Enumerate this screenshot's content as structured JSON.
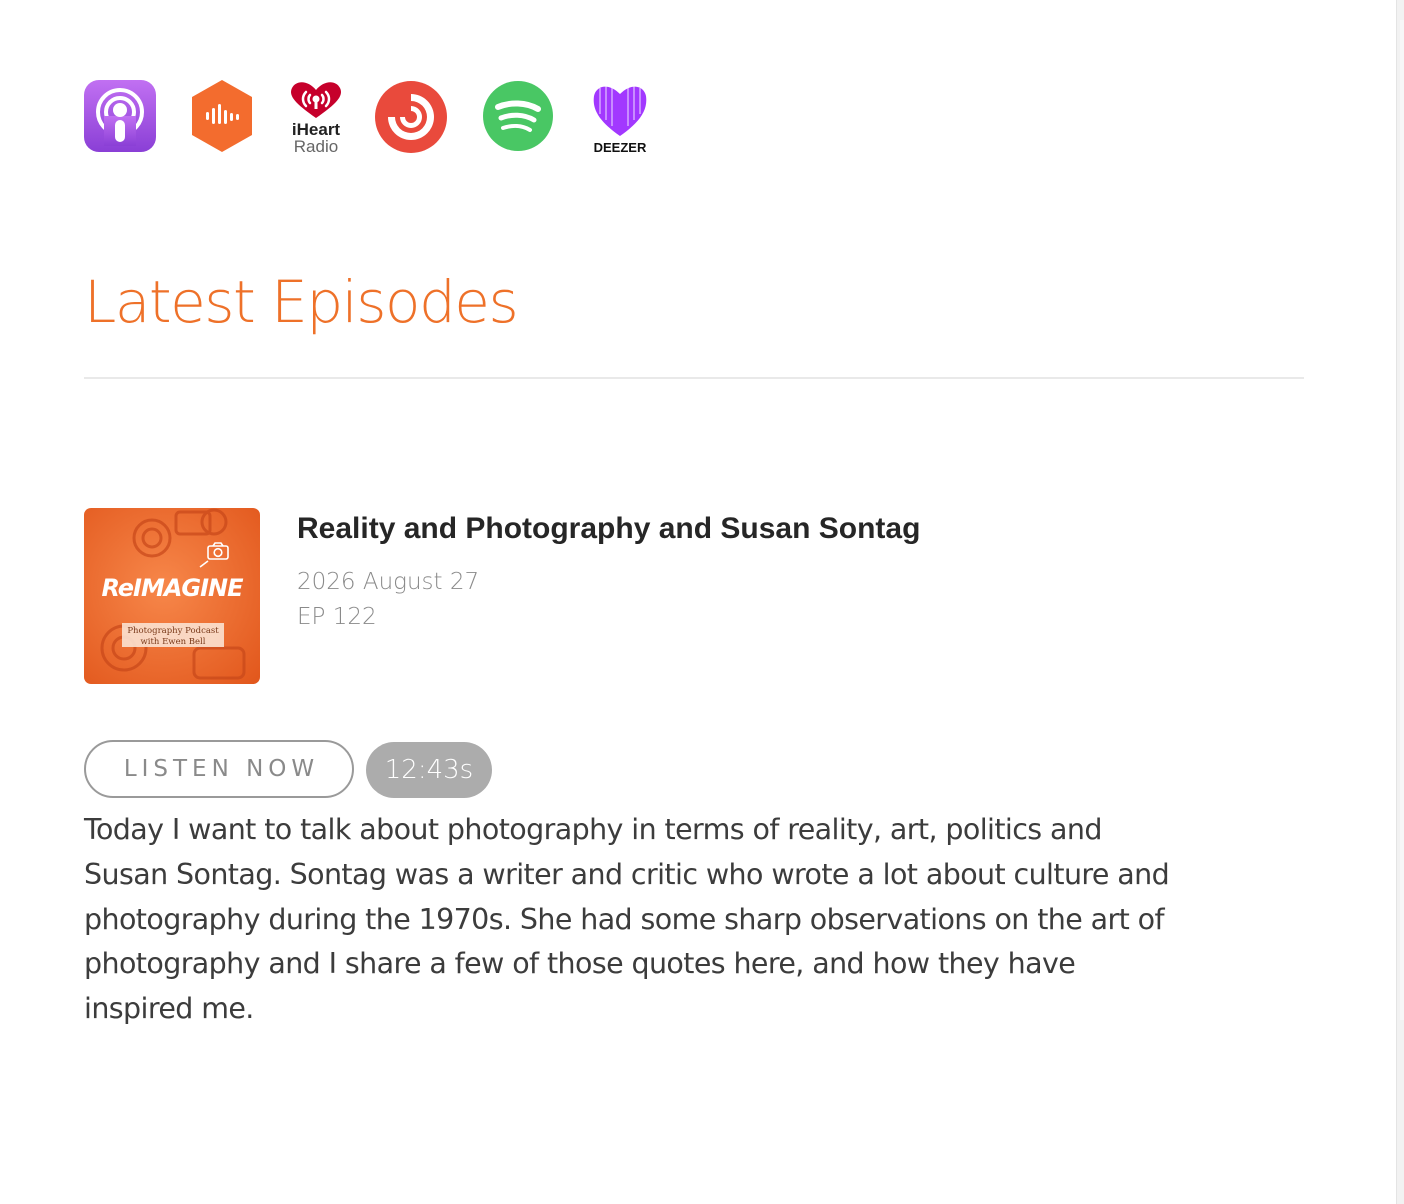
{
  "platforms": [
    {
      "name": "Apple Podcasts",
      "icon": "apple-podcasts-icon",
      "color": "#9B4DDF"
    },
    {
      "name": "Castbox",
      "icon": "castbox-icon",
      "color": "#F26B2D"
    },
    {
      "name": "iHeartRadio",
      "icon": "iheartradio-icon",
      "color": "#C6002B",
      "logo_text": [
        "iHeart",
        "Radio"
      ]
    },
    {
      "name": "Pocket Casts",
      "icon": "pocket-casts-icon",
      "color": "#F43E37"
    },
    {
      "name": "Spotify",
      "icon": "spotify-icon",
      "color": "#1ED760"
    },
    {
      "name": "Deezer",
      "icon": "deezer-icon",
      "color": "#A238FF",
      "logo_text": "DEEZER"
    }
  ],
  "section": {
    "title": "Latest Episodes"
  },
  "episode": {
    "cover": {
      "logo_text": "ReIMAGINE",
      "subtitle_lines": [
        "Photography Podcast",
        "with Ewen Bell"
      ],
      "accent": "#EE6A2A"
    },
    "title": "Reality and Photography and Susan Sontag",
    "date": "2026 August 27",
    "number": "EP 122",
    "listen_label": "LISTEN NOW",
    "duration": "12:43s",
    "description": "Today I want to talk about photography in terms of reality, art, politics and Susan Sontag. Sontag was a writer and critic who wrote a lot about culture and photography during the 1970s. She had some sharp observations on the art of photography and I share a few of those quotes here, and how they have inspired me."
  },
  "colors": {
    "accent_orange": "#EE7129",
    "duration_bg": "#ACACAC",
    "button_border": "#9A9A9A"
  }
}
